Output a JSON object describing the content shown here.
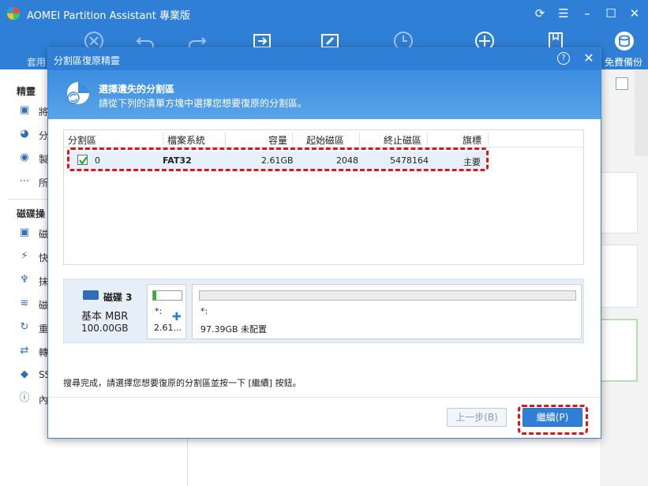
{
  "app": {
    "title": "AOMEI Partition Assistant 專業版",
    "toolbar_labels": {
      "apply": "套用",
      "free_backup": "免費備份"
    }
  },
  "sidebar": {
    "section1": "精靈",
    "section1_items": [
      "將",
      "分",
      "製",
      "所"
    ],
    "section2": "磁碟操",
    "section2_items": [
      "磁",
      "快",
      "抹",
      "磁",
      "重",
      "轉",
      "SS",
      "內"
    ]
  },
  "dialog": {
    "title": "分割區復原精靈",
    "help": "?",
    "header_title": "選擇遺失的分割區",
    "header_sub": "請從下列的清單方塊中選擇您想要復原的分割區。",
    "columns": [
      "分割區",
      "檔案系統",
      "容量",
      "起始磁區",
      "終止磁區",
      "旗標"
    ],
    "rows": [
      {
        "checked": true,
        "partition": "0",
        "fs": "FAT32",
        "capacity": "2.61GB",
        "start": "2048",
        "end": "5478164",
        "flag": "主要"
      }
    ],
    "disk": {
      "name": "磁碟 3",
      "type": "基本 MBR",
      "size": "100.00GB",
      "partitions": [
        {
          "label": "*:",
          "size": "2.61...",
          "used_fraction": 0.1
        },
        {
          "label": "*:",
          "size": "97.39GB 未配置"
        }
      ]
    },
    "status": "搜尋完成，請選擇您想要復原的分割區並按一下 [繼續] 按鈕。",
    "back_button": "上一步(B)",
    "next_button": "繼續(P)"
  }
}
